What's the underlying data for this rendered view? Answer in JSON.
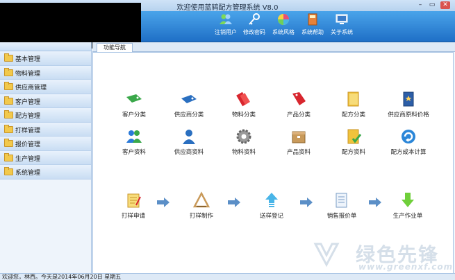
{
  "window": {
    "title": "欢迎使用蓝鸫配方管理系统 V8.0",
    "min": "–",
    "max": "▭",
    "close": "✕"
  },
  "toolbar": [
    {
      "label": "注销用户",
      "icon": "users-icon"
    },
    {
      "label": "修改密码",
      "icon": "key-icon"
    },
    {
      "label": "系统风格",
      "icon": "color-wheel-icon"
    },
    {
      "label": "系统帮助",
      "icon": "help-book-icon"
    },
    {
      "label": "关于系统",
      "icon": "computer-icon"
    }
  ],
  "tab": {
    "label": "功能导航"
  },
  "sidebar": {
    "items": [
      {
        "label": "基本管理"
      },
      {
        "label": "物料管理"
      },
      {
        "label": "供应商管理"
      },
      {
        "label": "客户管理"
      },
      {
        "label": "配方管理"
      },
      {
        "label": "打样管理"
      },
      {
        "label": "报价管理"
      },
      {
        "label": "生产管理"
      },
      {
        "label": "系统管理"
      }
    ]
  },
  "grid": {
    "row1": [
      {
        "label": "客户分类",
        "icon": "green-tag-icon",
        "color": "#3aa84a"
      },
      {
        "label": "供应商分类",
        "icon": "blue-tag-icon",
        "color": "#2a6fc0"
      },
      {
        "label": "物料分类",
        "icon": "red-tickets-icon",
        "color": "#d8262e"
      },
      {
        "label": "产品分类",
        "icon": "red-tag-icon",
        "color": "#d8262e"
      },
      {
        "label": "配方分类",
        "icon": "folder-icon",
        "color": "#f0c33c"
      },
      {
        "label": "供应商原料价格",
        "icon": "blue-book-icon",
        "color": "#2c5ea8"
      }
    ],
    "row2": [
      {
        "label": "客户资料",
        "icon": "users-group-icon",
        "color": "#2a7ad8"
      },
      {
        "label": "供应商资料",
        "icon": "user-icon",
        "color": "#2a6fc0"
      },
      {
        "label": "物料资料",
        "icon": "gear-icon",
        "color": "#8a8a8a"
      },
      {
        "label": "产品资料",
        "icon": "box-icon",
        "color": "#c99a5a"
      },
      {
        "label": "配方资料",
        "icon": "checked-note-icon",
        "color": "#f0c33c"
      },
      {
        "label": "配方成本计算",
        "icon": "refresh-icon",
        "color": "#2a86d8"
      }
    ],
    "flow": [
      {
        "label": "打样申请",
        "icon": "notepad-icon"
      },
      {
        "label": "打样制作",
        "icon": "triangle-tools-icon"
      },
      {
        "label": "送样登记",
        "icon": "upload-icon"
      },
      {
        "label": "销售报价单",
        "icon": "document-icon"
      },
      {
        "label": "生产作业单",
        "icon": "download-arrow-icon"
      }
    ]
  },
  "status": {
    "text": "欢迎您，林西。今天是2014年06月20日 星期五"
  },
  "watermark": {
    "text": "绿色先锋",
    "url": "www.greenxf.com"
  },
  "colors": {
    "toolbar_top": "#4aa4ea",
    "toolbar_bottom": "#1f6fc6",
    "arrow": "#5b8fc7"
  }
}
